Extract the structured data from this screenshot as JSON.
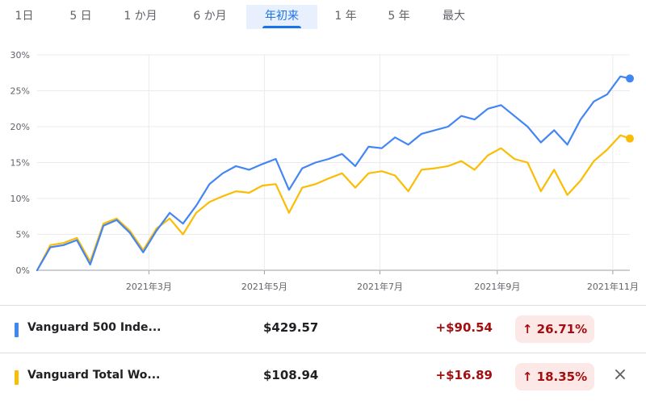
{
  "tabs": [
    "1日",
    "5 日",
    "1 か月",
    "6 か月",
    "年初来",
    "1 年",
    "5 年",
    "最大"
  ],
  "active_tab": "年初来",
  "funds": [
    {
      "name": "Vanguard 500 Inde...",
      "price": "$429.57",
      "change": "+$90.54",
      "pct": "↑ 26.71%",
      "color": "#4285f4"
    },
    {
      "name": "Vanguard Total Wo...",
      "price": "$108.94",
      "change": "+$16.89",
      "pct": "↑ 18.35%",
      "color": "#fbbc04"
    }
  ],
  "close_icon": "×",
  "chart_data": {
    "type": "line",
    "x": [
      "2021-01-01",
      "2021-01-08",
      "2021-01-15",
      "2021-01-22",
      "2021-01-29",
      "2021-02-05",
      "2021-02-12",
      "2021-02-19",
      "2021-02-26",
      "2021-03-05",
      "2021-03-12",
      "2021-03-19",
      "2021-03-26",
      "2021-04-02",
      "2021-04-09",
      "2021-04-16",
      "2021-04-23",
      "2021-04-30",
      "2021-05-07",
      "2021-05-14",
      "2021-05-21",
      "2021-05-28",
      "2021-06-04",
      "2021-06-11",
      "2021-06-18",
      "2021-06-25",
      "2021-07-02",
      "2021-07-09",
      "2021-07-16",
      "2021-07-23",
      "2021-07-30",
      "2021-08-06",
      "2021-08-13",
      "2021-08-20",
      "2021-08-27",
      "2021-09-03",
      "2021-09-10",
      "2021-09-17",
      "2021-09-24",
      "2021-10-01",
      "2021-10-08",
      "2021-10-15",
      "2021-10-22",
      "2021-10-29",
      "2021-11-05",
      "2021-11-10"
    ],
    "series": [
      {
        "name": "Vanguard 500 Inde...",
        "values": [
          0,
          3.2,
          3.5,
          4.2,
          0.8,
          6.2,
          7,
          5.2,
          2.5,
          5.5,
          8,
          6.5,
          9,
          12,
          13.5,
          14.5,
          14,
          14.8,
          15.5,
          11.2,
          14.2,
          15,
          15.5,
          16.2,
          14.5,
          17.2,
          17,
          18.5,
          17.5,
          19,
          19.5,
          20,
          21.5,
          21,
          22.5,
          23,
          21.5,
          20,
          17.8,
          19.5,
          17.5,
          21,
          23.5,
          24.5,
          27,
          26.71
        ]
      },
      {
        "name": "Vanguard Total Wo...",
        "values": [
          0,
          3.5,
          3.8,
          4.5,
          1.2,
          6.5,
          7.2,
          5.5,
          2.8,
          5.8,
          7.2,
          5,
          8,
          9.5,
          10.3,
          11,
          10.8,
          11.8,
          12,
          8,
          11.5,
          12,
          12.8,
          13.5,
          11.5,
          13.5,
          13.8,
          13.2,
          11,
          14,
          14.2,
          14.5,
          15.2,
          14,
          16,
          17,
          15.5,
          15,
          11,
          14,
          10.5,
          12.5,
          15.2,
          16.8,
          18.8,
          18.35
        ]
      }
    ],
    "xticks": [
      {
        "date": "2021-03-01",
        "label": "2021年3月"
      },
      {
        "date": "2021-05-01",
        "label": "2021年5月"
      },
      {
        "date": "2021-07-01",
        "label": "2021年7月"
      },
      {
        "date": "2021-09-01",
        "label": "2021年9月"
      },
      {
        "date": "2021-11-01",
        "label": "2021年11月"
      }
    ],
    "yticks": [
      "0%",
      "5%",
      "10%",
      "15%",
      "20%",
      "25%",
      "30%"
    ],
    "ylim": [
      0,
      30
    ],
    "xlim": [
      "2021-01-01",
      "2021-11-10"
    ],
    "grid": true
  }
}
